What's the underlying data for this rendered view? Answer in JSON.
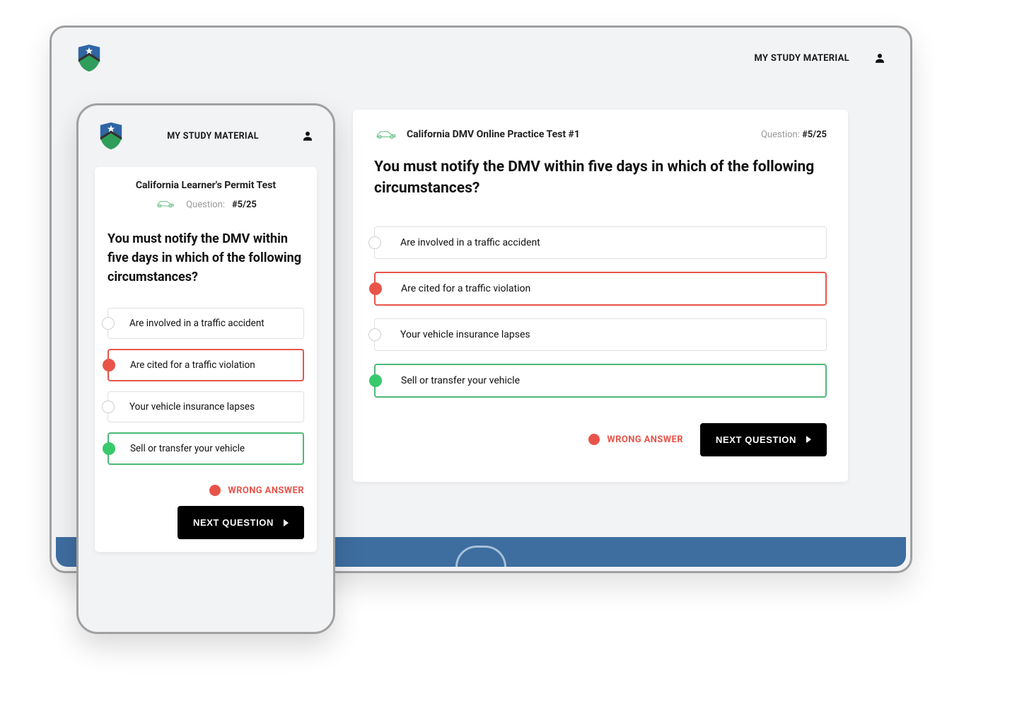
{
  "header": {
    "study_material_label": "MY STUDY MATERIAL"
  },
  "desktop": {
    "quiz_title": "California DMV Online Practice Test #1",
    "question_label": "Question:",
    "question_number": "#5/25",
    "question_text": "You must notify the DMV within five days in which of the following circumstances?",
    "answers": [
      {
        "text": "Are involved in a traffic accident",
        "state": "default"
      },
      {
        "text": "Are cited for a traffic violation",
        "state": "wrong"
      },
      {
        "text": "Your vehicle insurance lapses",
        "state": "default"
      },
      {
        "text": "Sell or transfer your vehicle",
        "state": "correct"
      }
    ],
    "wrong_answer_label": "WRONG ANSWER",
    "next_button_label": "NEXT QUESTION"
  },
  "mobile": {
    "quiz_title": "California Learner's Permit Test",
    "question_label": "Question:",
    "question_number": "#5/25",
    "question_text": "You must notify the DMV within five days in which of the following circumstances?",
    "answers": [
      {
        "text": "Are involved in a traffic accident",
        "state": "default"
      },
      {
        "text": "Are cited for a traffic violation",
        "state": "wrong"
      },
      {
        "text": "Your vehicle insurance lapses",
        "state": "default"
      },
      {
        "text": "Sell or transfer your vehicle",
        "state": "correct"
      }
    ],
    "wrong_answer_label": "WRONG ANSWER",
    "next_button_label": "NEXT QUESTION"
  }
}
